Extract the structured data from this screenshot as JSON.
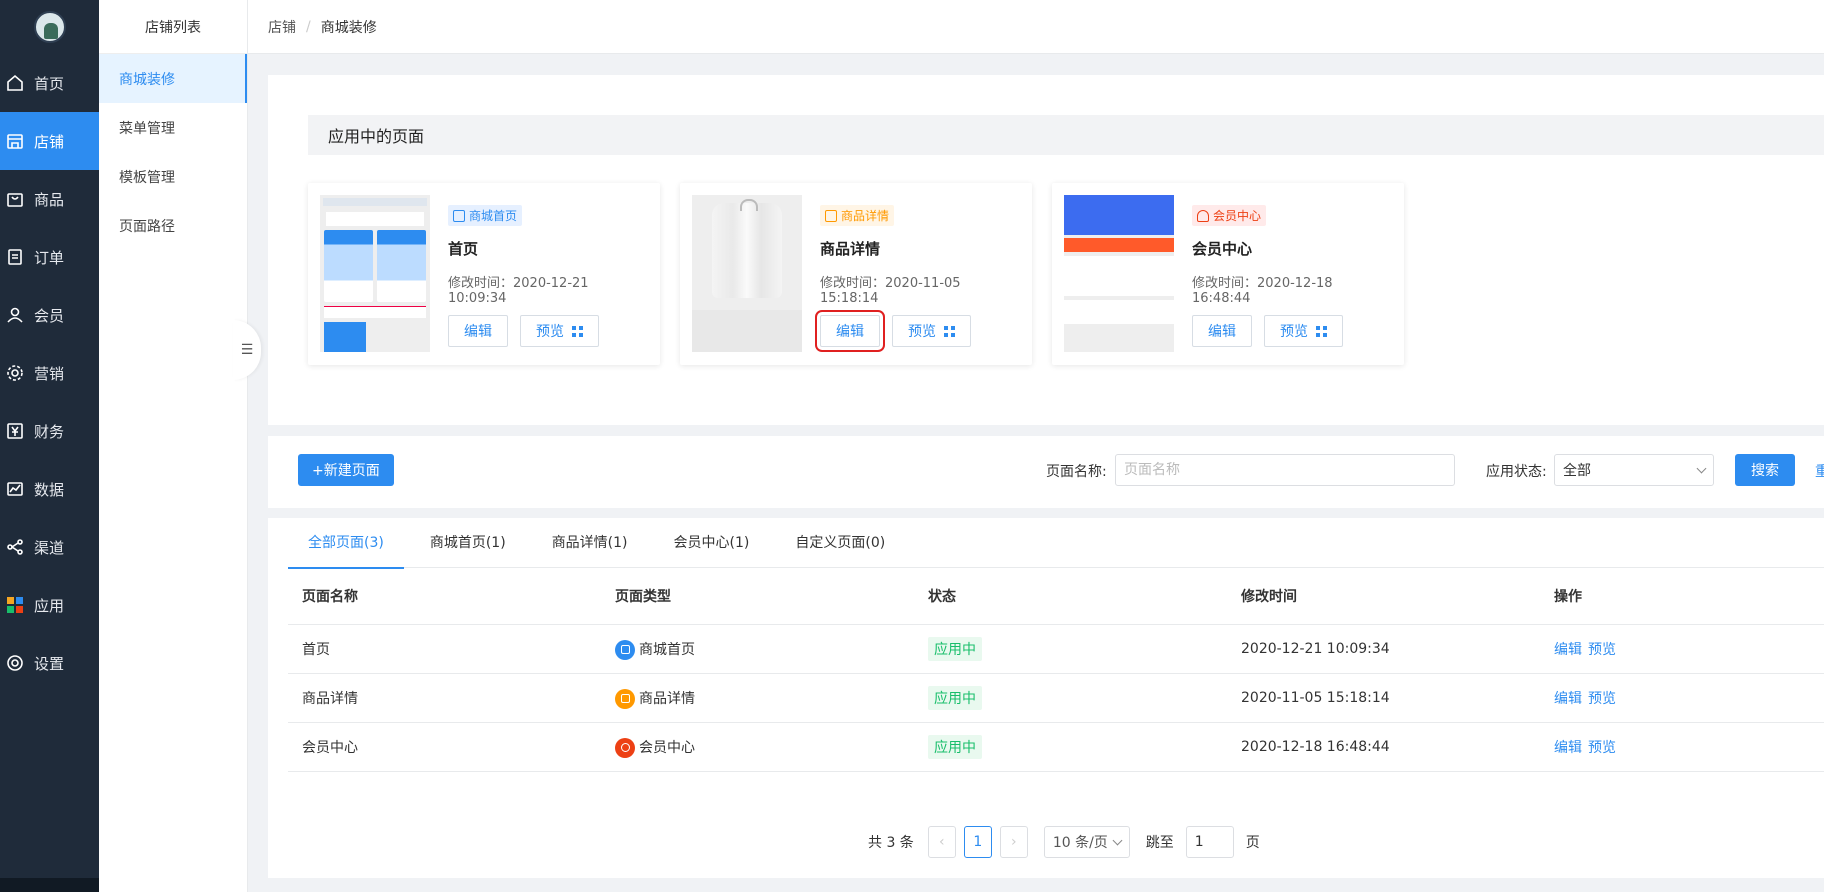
{
  "nav": {
    "items": [
      {
        "label": "首页",
        "icon": "home-icon"
      },
      {
        "label": "店铺",
        "icon": "store-icon",
        "active": true
      },
      {
        "label": "商品",
        "icon": "bag-icon"
      },
      {
        "label": "订单",
        "icon": "order-icon"
      },
      {
        "label": "会员",
        "icon": "user-icon"
      },
      {
        "label": "营销",
        "icon": "gear-icon"
      },
      {
        "label": "财务",
        "icon": "yen-icon"
      },
      {
        "label": "数据",
        "icon": "chart-icon"
      },
      {
        "label": "渠道",
        "icon": "share-icon"
      },
      {
        "label": "应用",
        "icon": "apps-icon"
      },
      {
        "label": "设置",
        "icon": "settings-icon"
      }
    ]
  },
  "sidebar": {
    "title": "店铺列表",
    "items": [
      {
        "label": "商城装修",
        "active": true
      },
      {
        "label": "菜单管理"
      },
      {
        "label": "模板管理"
      },
      {
        "label": "页面路径"
      }
    ]
  },
  "breadcrumb": {
    "root": "店铺",
    "sep": "/",
    "current": "商城装修"
  },
  "applied": {
    "title": "应用中的页面",
    "cards": [
      {
        "tag": "商城首页",
        "name": "首页",
        "time": "修改时间：2020-12-21 10:09:34",
        "edit": "编辑",
        "preview": "预览"
      },
      {
        "tag": "商品详情",
        "name": "商品详情",
        "time": "修改时间：2020-11-05 15:18:14",
        "edit": "编辑",
        "preview": "预览"
      },
      {
        "tag": "会员中心",
        "name": "会员中心",
        "time": "修改时间：2020-12-18 16:48:44",
        "edit": "编辑",
        "preview": "预览"
      }
    ]
  },
  "toolbar": {
    "new_page": "+新建页面",
    "name_label": "页面名称:",
    "name_placeholder": "页面名称",
    "status_label": "应用状态:",
    "status_value": "全部",
    "search": "搜索",
    "reset": "重"
  },
  "tabs": [
    "全部页面(3)",
    "商城首页(1)",
    "商品详情(1)",
    "会员中心(1)",
    "自定义页面(0)"
  ],
  "table": {
    "headers": [
      "页面名称",
      "页面类型",
      "状态",
      "修改时间",
      "操作"
    ],
    "rows": [
      {
        "name": "首页",
        "type": "商城首页",
        "status": "应用中",
        "time": "2020-12-21 10:09:34",
        "edit": "编辑",
        "preview": "预览"
      },
      {
        "name": "商品详情",
        "type": "商品详情",
        "status": "应用中",
        "time": "2020-11-05 15:18:14",
        "edit": "编辑",
        "preview": "预览"
      },
      {
        "name": "会员中心",
        "type": "会员中心",
        "status": "应用中",
        "time": "2020-12-18 16:48:44",
        "edit": "编辑",
        "preview": "预览"
      }
    ]
  },
  "pager": {
    "total": "共 3 条",
    "current": "1",
    "size": "10 条/页",
    "jump": "跳至",
    "jump_value": "1",
    "page_unit": "页"
  },
  "colors": {
    "primary": "#2d8cf0",
    "nav_bg": "#1f2b3a",
    "success": "#19be6b",
    "orange": "#ff9900",
    "red": "#ed4014"
  }
}
